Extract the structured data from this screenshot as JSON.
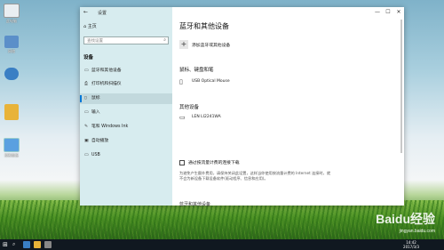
{
  "desktop": {
    "icons": [
      {
        "label": "此电脑",
        "color": "#f0f0f0"
      },
      {
        "label": "网络",
        "color": "#4a90d9"
      },
      {
        "label": "",
        "color": "#e8b339"
      },
      {
        "label": "控制面板",
        "color": "#5aa0e0"
      }
    ]
  },
  "sidebar": {
    "title": "设置",
    "home": "主页",
    "search_placeholder": "查找设置",
    "section": "设备",
    "items": [
      {
        "label": "蓝牙和其他设备",
        "icon": "bluetooth-icon",
        "glyph": "▭"
      },
      {
        "label": "打印机和扫描仪",
        "icon": "printer-icon",
        "glyph": "⎙"
      },
      {
        "label": "鼠标",
        "icon": "mouse-icon",
        "glyph": "▯"
      },
      {
        "label": "输入",
        "icon": "keyboard-icon",
        "glyph": "▭"
      },
      {
        "label": "笔和 Windows Ink",
        "icon": "pen-icon",
        "glyph": "✎"
      },
      {
        "label": "自动播放",
        "icon": "autoplay-icon",
        "glyph": "▣"
      },
      {
        "label": "USB",
        "icon": "usb-icon",
        "glyph": "▭"
      }
    ]
  },
  "main": {
    "title": "蓝牙和其他设备",
    "add_device": "添加蓝牙或其他设备",
    "mouse_section": "鼠标、键盘和笔",
    "mouse_device": "USB Optical Mouse",
    "other_section": "其他设备",
    "other_device": "LEN LI2241WA",
    "metered_label": "通过按流量计费的连接下载",
    "metered_desc": "为避免产生额外费用，请保持关闭此设置，这样当你使用按流量计费的 Internet 连接时，就不会为新设备下载设备软件(驱动程序、信息和应用)。",
    "cut_off_text": "蓝牙和其他设备"
  },
  "window_controls": {
    "minimize": "—",
    "maximize": "☐",
    "close": "✕"
  },
  "taskbar": {
    "start_glyph": "⊞",
    "search_glyph": "⌕",
    "time": "14:42",
    "date": "2017/3/3"
  },
  "watermark": {
    "main": "Baidu经验",
    "sub": "jingyan.baidu.com"
  },
  "colors": {
    "accent": "#0078d7",
    "sidebar_bg": "#d7ecef"
  }
}
